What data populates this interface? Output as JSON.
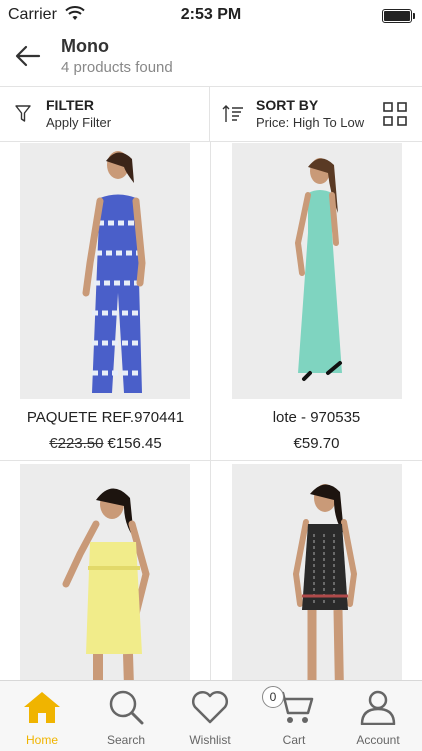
{
  "status_bar": {
    "carrier": "Carrier",
    "time": "2:53 PM"
  },
  "header": {
    "title": "Mono",
    "subtitle": "4 products found"
  },
  "toolbar": {
    "filter_title": "FILTER",
    "filter_sub": "Apply Filter",
    "sort_title": "SORT BY",
    "sort_sub": "Price: High To Low"
  },
  "products": [
    {
      "name": "PAQUETE REF.970441",
      "old_price": "€223.50",
      "price": "€156.45",
      "dress_color": "#4a5fc9"
    },
    {
      "name": "lote - 970535",
      "old_price": "",
      "price": "€59.70",
      "dress_color": "#7fd4c0"
    },
    {
      "name": "",
      "old_price": "",
      "price": "",
      "dress_color": "#f1ec8a"
    },
    {
      "name": "",
      "old_price": "",
      "price": "",
      "dress_color": "#2a2a2a"
    }
  ],
  "tabbar": {
    "items": [
      {
        "label": "Home",
        "icon": "home-icon",
        "active": true
      },
      {
        "label": "Search",
        "icon": "search-icon"
      },
      {
        "label": "Wishlist",
        "icon": "heart-icon"
      },
      {
        "label": "Cart",
        "icon": "cart-icon"
      },
      {
        "label": "Account",
        "icon": "account-icon"
      }
    ],
    "cart_count": "0",
    "accent": "#f0b400"
  }
}
